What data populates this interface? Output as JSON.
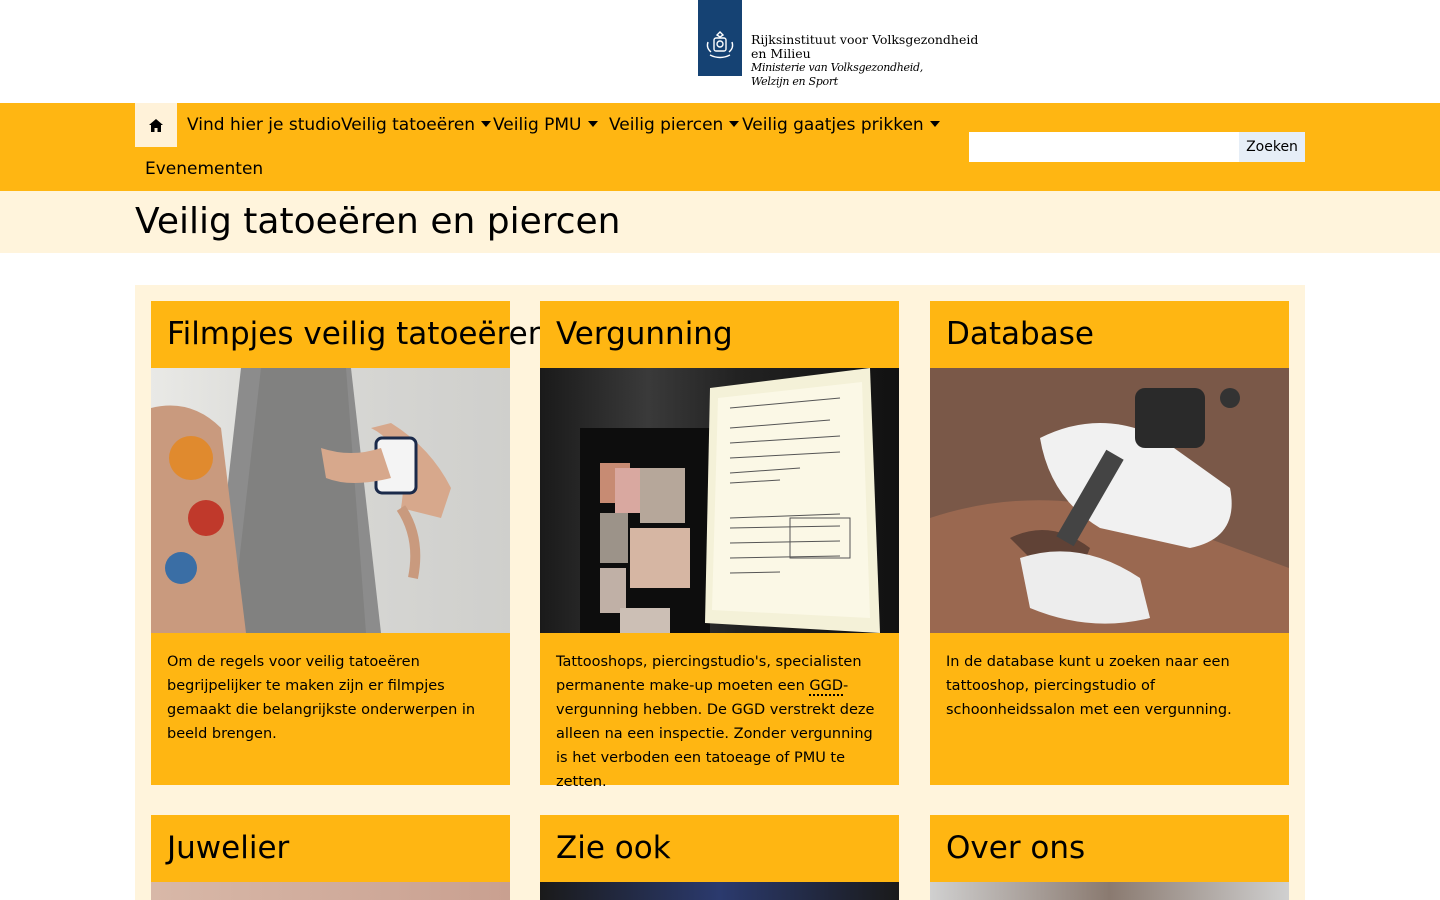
{
  "header": {
    "logo_line1": "Rijksinstituut voor Volksgezondheid",
    "logo_line2": "en Milieu",
    "logo_line3": "Ministerie van Volksgezondheid,",
    "logo_line4": "Welzijn en Sport",
    "logo_color": "#154273"
  },
  "nav": {
    "home_icon": "home-icon",
    "items": [
      {
        "label": "Vind hier je studio",
        "dropdown": false
      },
      {
        "label": "Veilig tatoeëren",
        "dropdown": true
      },
      {
        "label": "Veilig PMU",
        "dropdown": true
      },
      {
        "label": "Veilig piercen",
        "dropdown": true
      },
      {
        "label": "Veilig gaatjes prikken",
        "dropdown": true
      },
      {
        "label": "Evenementen",
        "dropdown": false
      }
    ],
    "search_placeholder": "",
    "search_button": "Zoeken",
    "bar_color": "#ffb612"
  },
  "page": {
    "title": "Veilig tatoeëren en piercen"
  },
  "cards": [
    {
      "title": "Filmpjes veilig tatoeëren",
      "image": "tattooed-arm-with-mug",
      "text": "Om de regels voor veilig tatoeëren begrijpelijker te maken zijn er filmpjes gemaakt die belangrijkste onderwerpen in beeld brengen."
    },
    {
      "title": "Vergunning",
      "image": "permit-in-shop-window",
      "text_before": "Tattooshops, piercingstudio's, specialisten permanente make-up moeten een ",
      "abbr": "GGD",
      "text_after": "-vergunning hebben. De GGD verstrekt deze alleen na een inspectie. Zonder vergunning is het verboden een tatoeage of PMU te zetten."
    },
    {
      "title": "Database",
      "image": "tattoo-machine-in-use",
      "text": "In de database kunt u zoeken naar een tattooshop, piercingstudio of schoonheidssalon met een vergunning."
    },
    {
      "title": "Juwelier"
    },
    {
      "title": "Zie ook"
    },
    {
      "title": "Over ons"
    }
  ]
}
